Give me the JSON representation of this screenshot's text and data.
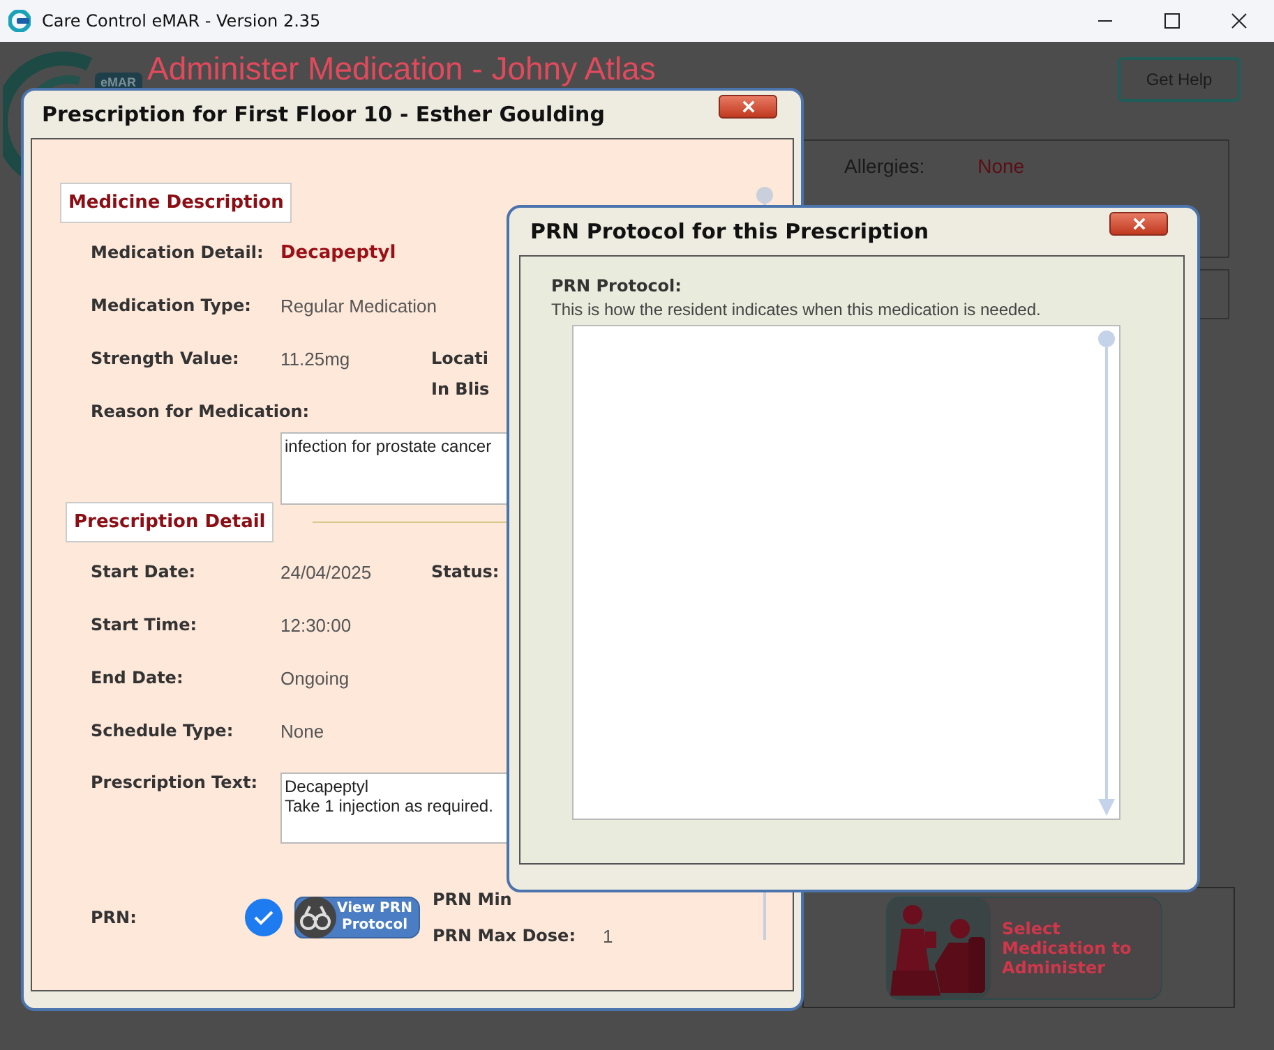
{
  "window": {
    "title": "Care Control eMAR - Version 2.35"
  },
  "app": {
    "logo_badge": "eMAR",
    "title": "Administer Medication - Johny Atlas",
    "help_button": "Get Help",
    "allergies": {
      "label": "Allergies:",
      "value": "None"
    },
    "action_button": "Select Medication to Administer"
  },
  "prescription_dialog": {
    "title": "Prescription for First Floor 10 - Esther Goulding",
    "sections": [
      {
        "heading": "Medicine Description",
        "rows": [
          {
            "kind": "highlight",
            "label": "Medication Detail:",
            "value": "Decapeptyl"
          },
          {
            "kind": "text",
            "label": "Medication Type:",
            "value": "Regular Medication"
          },
          {
            "kind": "text",
            "label": "Strength Value:",
            "value": "11.25mg",
            "side_label": "Locati"
          },
          {
            "kind": "note",
            "label": "Reason for Medication:",
            "value": "infection for prostate cancer",
            "side_label": "In Blis"
          }
        ]
      },
      {
        "heading": "Prescription Detail",
        "rows": [
          {
            "kind": "text",
            "label": "Start Date:",
            "value": "24/04/2025",
            "side_label": "Status:"
          },
          {
            "kind": "text",
            "label": "Start Time:",
            "value": "12:30:00"
          },
          {
            "kind": "text",
            "label": "End Date:",
            "value": "Ongoing"
          },
          {
            "kind": "text",
            "label": "Schedule Type:",
            "value": "None"
          },
          {
            "kind": "box",
            "label": "Prescription Text:",
            "value": "Decapeptyl\nTake 1 injection as required."
          },
          {
            "kind": "prn",
            "label": "PRN:",
            "checked": true,
            "button": "View PRN Protocol",
            "doses": [
              {
                "label": "PRN Min"
              },
              {
                "label": "PRN Max Dose:",
                "value": "1"
              }
            ]
          }
        ]
      }
    ]
  },
  "prn_dialog": {
    "title": "PRN Protocol for this Prescription",
    "heading": "PRN Protocol:",
    "description": "This is how the resident indicates when this medication is needed."
  }
}
